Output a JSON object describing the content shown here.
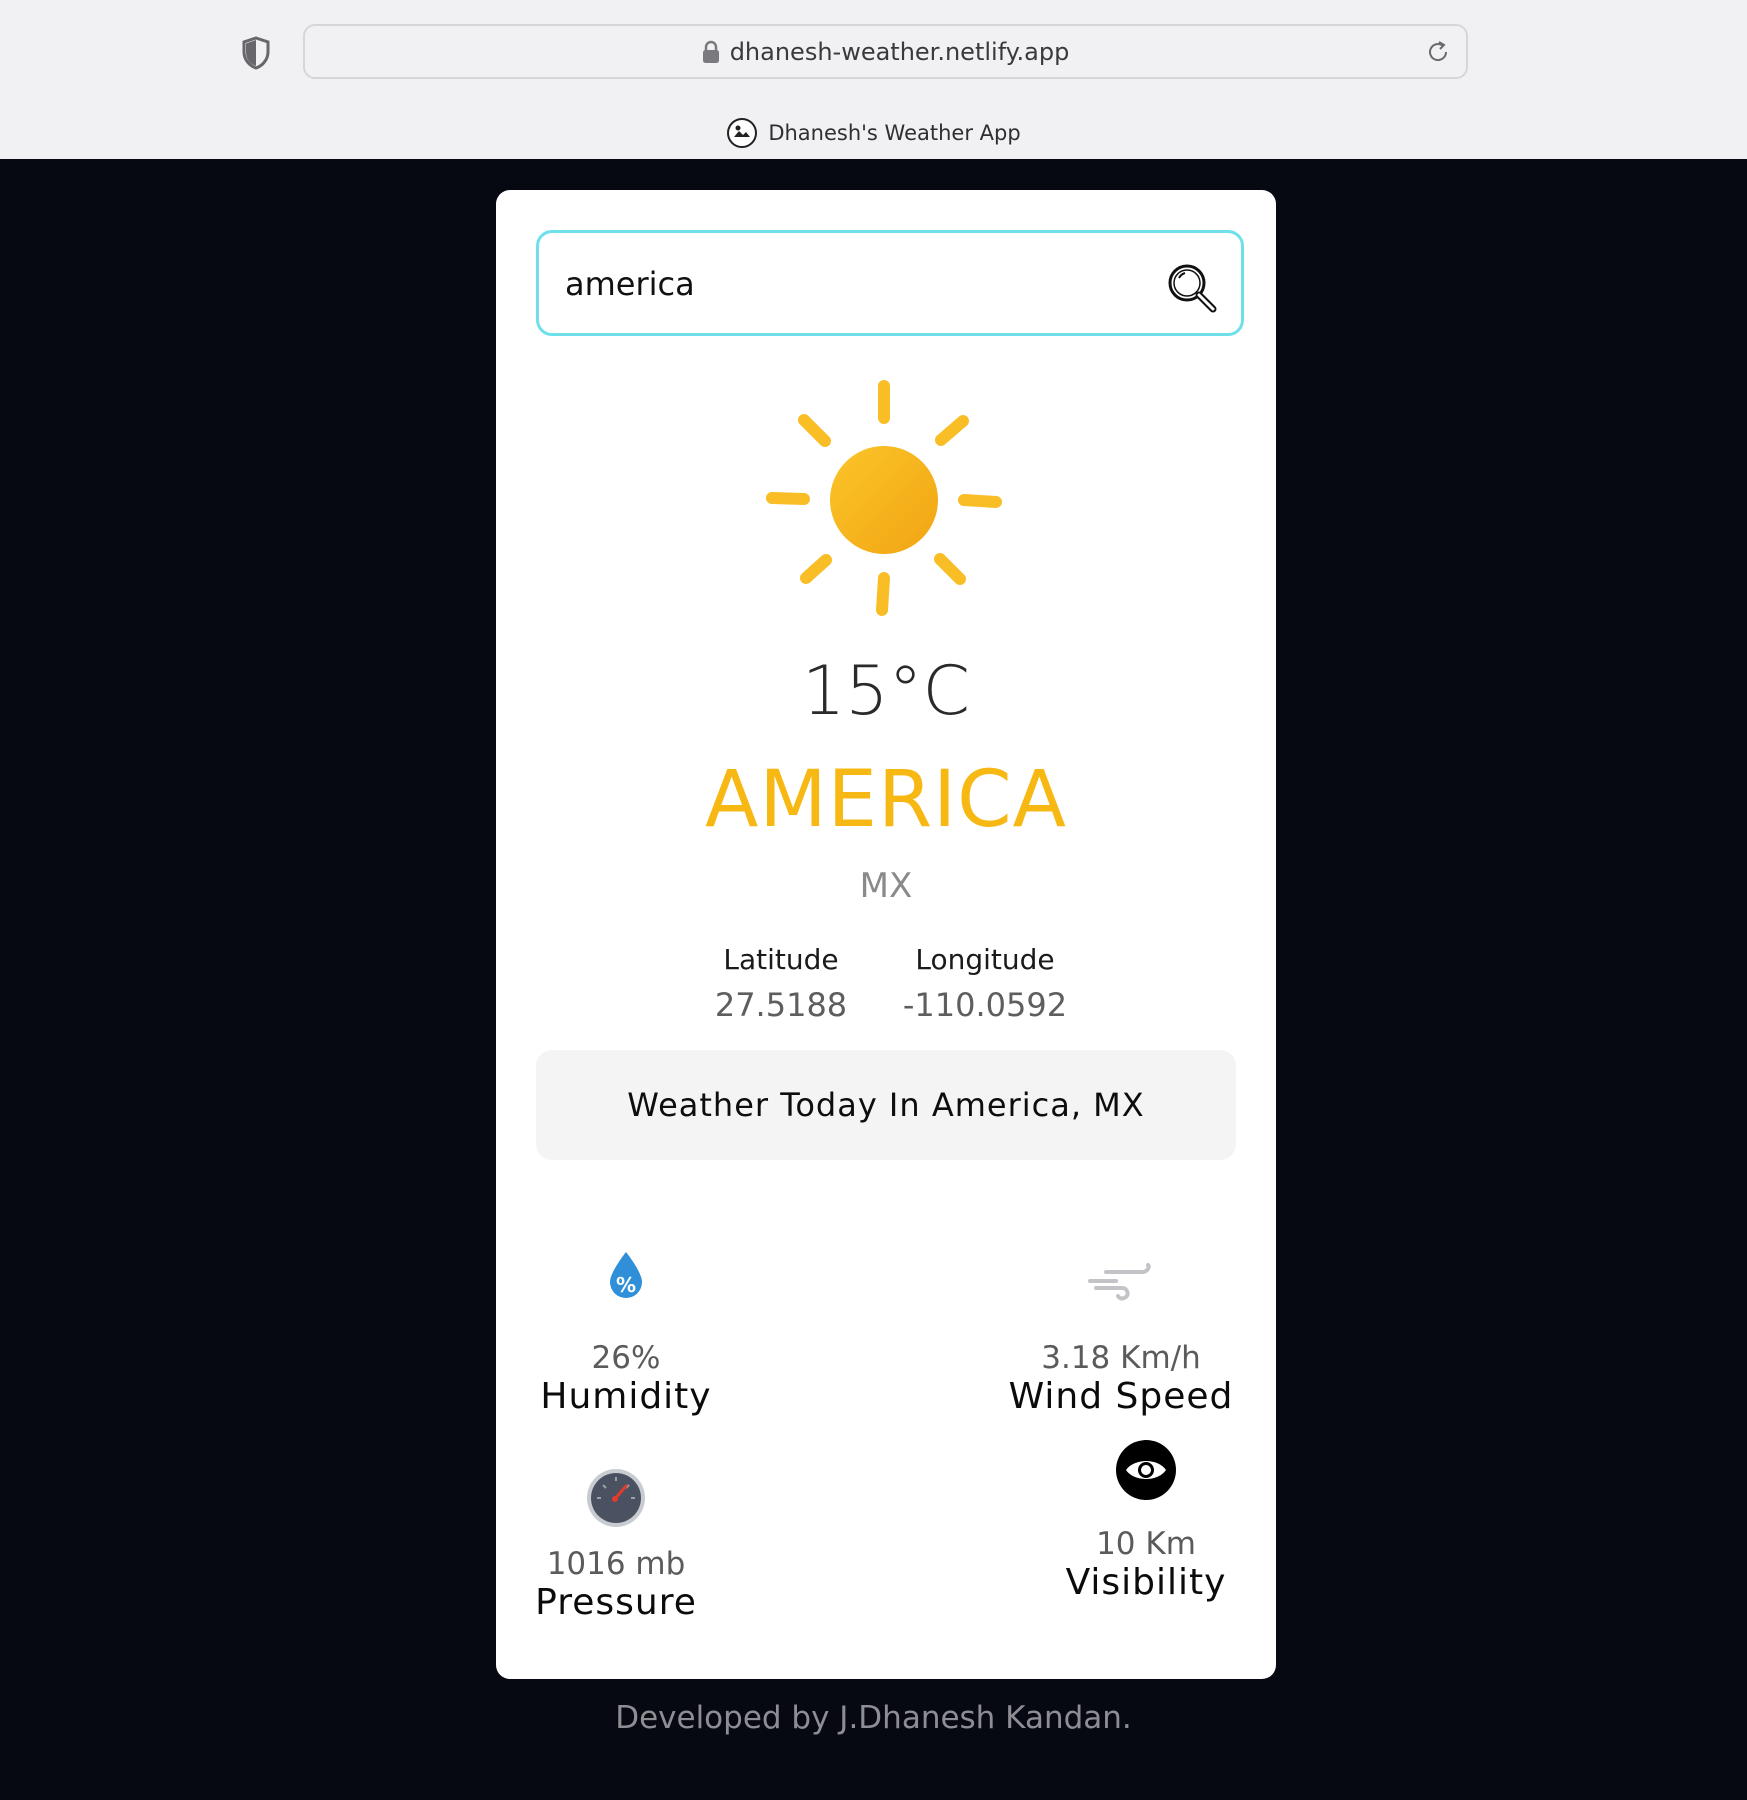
{
  "browser": {
    "url": "dhanesh-weather.netlify.app",
    "tab_title": "Dhanesh's Weather App"
  },
  "search": {
    "value": "america"
  },
  "weather": {
    "temperature": "15°C",
    "city": "AMERICA",
    "country": "MX",
    "latitude_label": "Latitude",
    "latitude": "27.5188",
    "longitude_label": "Longitude",
    "longitude": "-110.0592",
    "today_heading": "Weather Today In America, MX"
  },
  "stats": {
    "humidity": {
      "value": "26%",
      "label": "Humidity"
    },
    "wind": {
      "value": "3.18 Km/h",
      "label": "Wind Speed"
    },
    "pressure": {
      "value": "1016 mb",
      "label": "Pressure"
    },
    "visibility": {
      "value": "10 Km",
      "label": "Visibility"
    }
  },
  "footer": {
    "text": "Developed by J.Dhanesh Kandan."
  },
  "colors": {
    "accent_city": "#f7b814",
    "search_border": "#6fe0ea",
    "background": "#060812"
  },
  "icons": {
    "sun": "sun-icon",
    "humidity": "humidity-drop-icon",
    "wind": "wind-icon",
    "pressure": "gauge-icon",
    "visibility": "eye-icon",
    "search": "magnifier-icon"
  }
}
